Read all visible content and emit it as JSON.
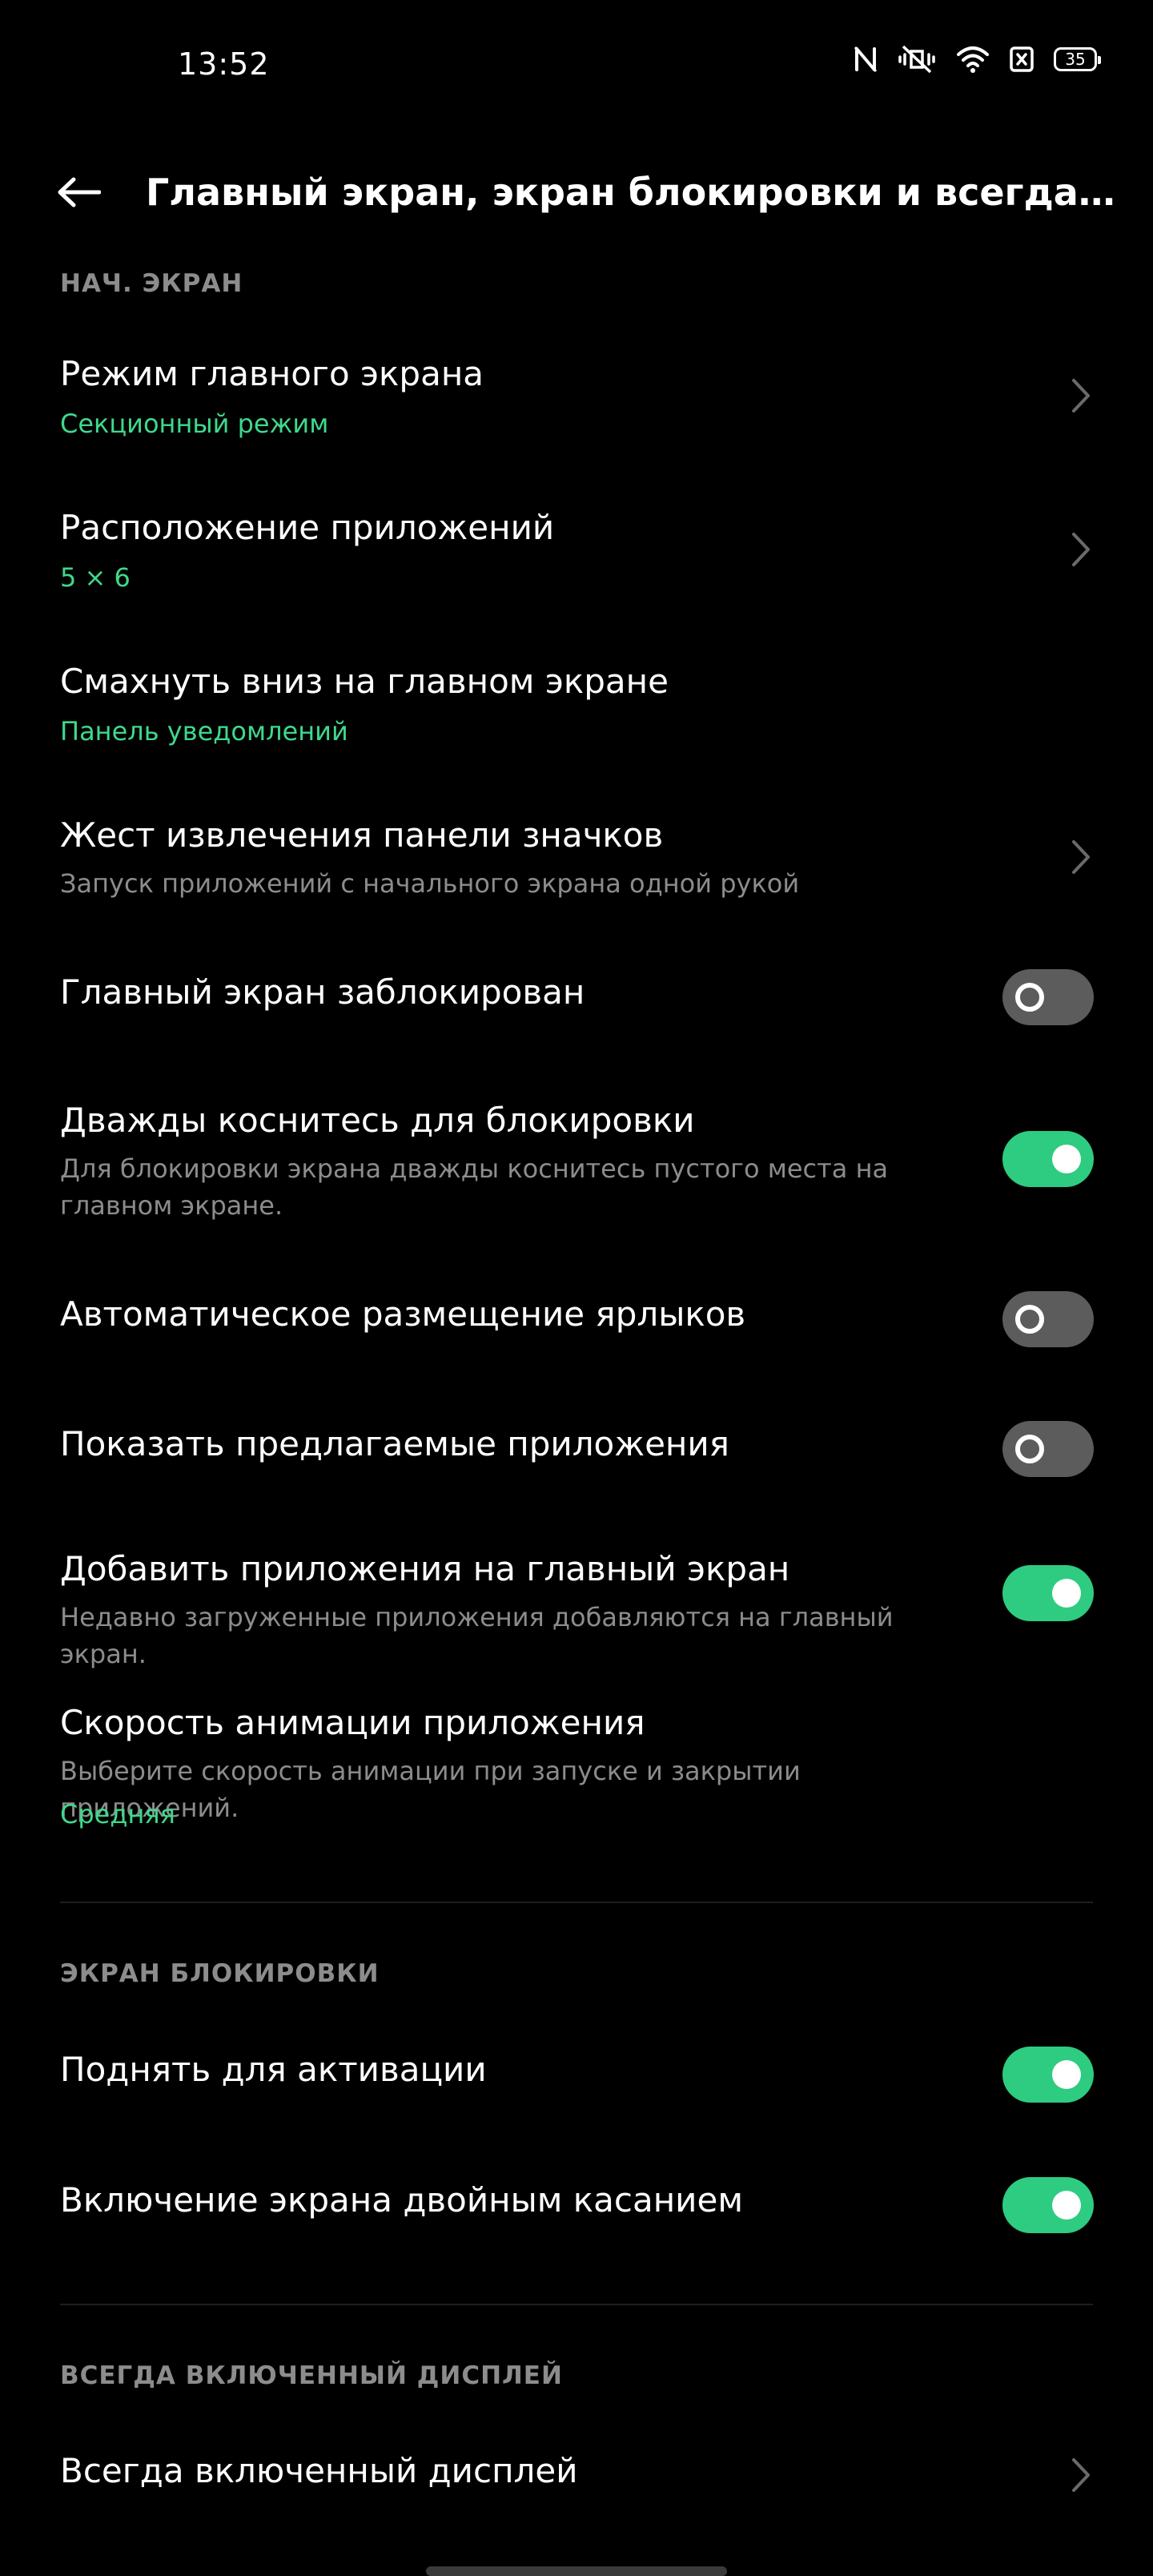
{
  "status_bar": {
    "time": "13:52",
    "battery": "35"
  },
  "header": {
    "title": "Главный экран, экран блокировки и всегда включ..."
  },
  "colors": {
    "accent": "#3ed98c",
    "toggle_on": "#2ecc80",
    "toggle_off": "#5c5c5c",
    "secondary_text": "#8c8c8c",
    "background": "#000000"
  },
  "sections": {
    "home": {
      "header": "НАЧ. ЭКРАН",
      "items": [
        {
          "title": "Режим главного экрана",
          "value": "Секционный режим",
          "control": "chevron"
        },
        {
          "title": "Расположение приложений",
          "value": "5 × 6",
          "control": "chevron"
        },
        {
          "title": "Смахнуть вниз на главном экране",
          "value": "Панель уведомлений",
          "control": "none"
        },
        {
          "title": "Жест извлечения панели значков",
          "subtitle": "Запуск приложений с начального экрана одной рукой",
          "control": "chevron"
        },
        {
          "title": "Главный экран заблокирован",
          "control": "toggle",
          "state": "off"
        },
        {
          "title": "Дважды коснитесь для блокировки",
          "subtitle": "Для блокировки экрана дважды коснитесь пустого места на главном экране.",
          "control": "toggle",
          "state": "on"
        },
        {
          "title": "Автоматическое размещение ярлыков",
          "control": "toggle",
          "state": "off"
        },
        {
          "title": "Показать предлагаемые приложения",
          "control": "toggle",
          "state": "off"
        },
        {
          "title": "Добавить приложения на главный экран",
          "subtitle": "Недавно загруженные приложения добавляются на главный экран.",
          "control": "toggle",
          "state": "on"
        },
        {
          "title": "Скорость анимации приложения",
          "subtitle": "Выберите скорость анимации при запуске и закрытии приложений.",
          "value": "Средняя",
          "control": "none"
        }
      ]
    },
    "lock": {
      "header": "ЭКРАН БЛОКИРОВКИ",
      "items": [
        {
          "title": "Поднять для активации",
          "control": "toggle",
          "state": "on"
        },
        {
          "title": "Включение экрана двойным касанием",
          "control": "toggle",
          "state": "on"
        }
      ]
    },
    "aod": {
      "header": "ВСЕГДА ВКЛЮЧЕННЫЙ ДИСПЛЕЙ",
      "items": [
        {
          "title": "Всегда включенный дисплей",
          "control": "chevron"
        }
      ]
    }
  }
}
